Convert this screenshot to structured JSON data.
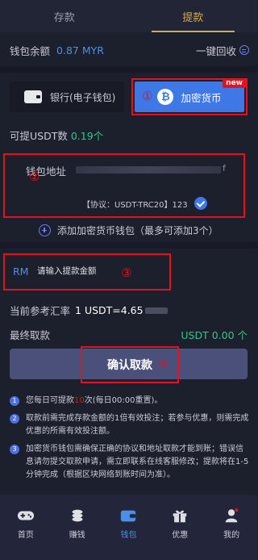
{
  "tabs": [
    {
      "label": "存款",
      "active": false
    },
    {
      "label": "提款",
      "active": true
    }
  ],
  "balance": {
    "label": "钱包余额",
    "value": "0.87 MYR",
    "recycle_label": "一键回收"
  },
  "methods": {
    "bank_label": "银行(电子钱包)",
    "crypto_label": "加密货币",
    "crypto_badge": "new",
    "crypto_icon": "bitcoin-icon"
  },
  "available": {
    "label": "可提USDT数",
    "value": "0.19个"
  },
  "wallet": {
    "address_label": "钱包地址",
    "address_tail": "f",
    "protocol": "【协议：USDT-TRC20】123"
  },
  "add_wallet_label": "添加加密货币钱包（最多可添加3个）",
  "amount": {
    "currency": "RM",
    "placeholder": "请输入提款金额"
  },
  "rate": {
    "label": "当前参考汇率",
    "value": "1 USDT=4.65"
  },
  "final_amount": {
    "label": "最终取款",
    "value": "USDT 0.00 个"
  },
  "confirm_label": "确认取款",
  "annotations": [
    "①",
    "②",
    "③",
    "④"
  ],
  "notes": [
    {
      "num": "1",
      "pre": "您每日可提款",
      "highlight": "10",
      "post": "次(每日00:00重置)。"
    },
    {
      "num": "2",
      "text": "取款前需完成存款金额的1倍有效投注；若参与优惠，则需完成优惠的所需有效投注额。"
    },
    {
      "num": "3",
      "text": "加密货币钱包需确保正确的协议和地址取款才能到账；错误信息请勿提交取款申请，需立即联系在线客服修改；提款将在1-5分钟完成（根据区块网络到账时间为准）。"
    }
  ],
  "nav": [
    {
      "label": "首页",
      "icon": "gamepad-icon",
      "active": false
    },
    {
      "label": "赚钱",
      "icon": "coins-icon",
      "active": false
    },
    {
      "label": "钱包",
      "icon": "wallet-icon",
      "active": true
    },
    {
      "label": "优惠",
      "icon": "gift-icon",
      "active": false
    },
    {
      "label": "我的",
      "icon": "user-icon",
      "active": false
    }
  ],
  "colors": {
    "accent_gold": "#d6a94e",
    "blue": "#4d8fe8",
    "green": "#36c58a",
    "highlight_red": "#e0141e"
  }
}
